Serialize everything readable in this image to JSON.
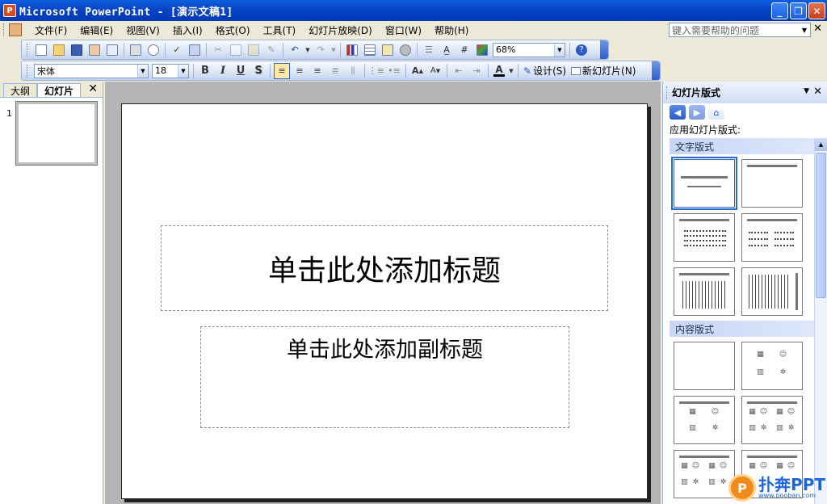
{
  "window": {
    "title": "Microsoft PowerPoint - [演示文稿1]",
    "app_icon_letter": "P",
    "controls": {
      "minimize": "_",
      "restore": "❐",
      "close": "✕"
    }
  },
  "menu": {
    "items": [
      "文件(F)",
      "编辑(E)",
      "视图(V)",
      "插入(I)",
      "格式(O)",
      "工具(T)",
      "幻灯片放映(D)",
      "窗口(W)",
      "帮助(H)"
    ],
    "help_placeholder": "键入需要帮助的问题",
    "doc_close": "✕"
  },
  "standard_toolbar": {
    "zoom": "68%"
  },
  "format_toolbar": {
    "font": "宋体",
    "size": "18",
    "bold": "B",
    "italic": "I",
    "underline": "U",
    "shadow": "S",
    "font_color_label": "A",
    "design_label": "设计(S)",
    "new_slide_label": "新幻灯片(N)"
  },
  "left_pane": {
    "tabs": [
      "大纲",
      "幻灯片"
    ],
    "active_tab": "幻灯片",
    "close": "✕",
    "slide_number": "1"
  },
  "slide": {
    "title_placeholder": "单击此处添加标题",
    "subtitle_placeholder": "单击此处添加副标题"
  },
  "task_pane": {
    "title": "幻灯片版式",
    "close": "✕",
    "apply_label": "应用幻灯片版式:",
    "sections": [
      "文字版式",
      "内容版式"
    ]
  },
  "watermark": {
    "logo": "P",
    "brand": "扑奔PPT",
    "url": "www.pooban.com"
  }
}
